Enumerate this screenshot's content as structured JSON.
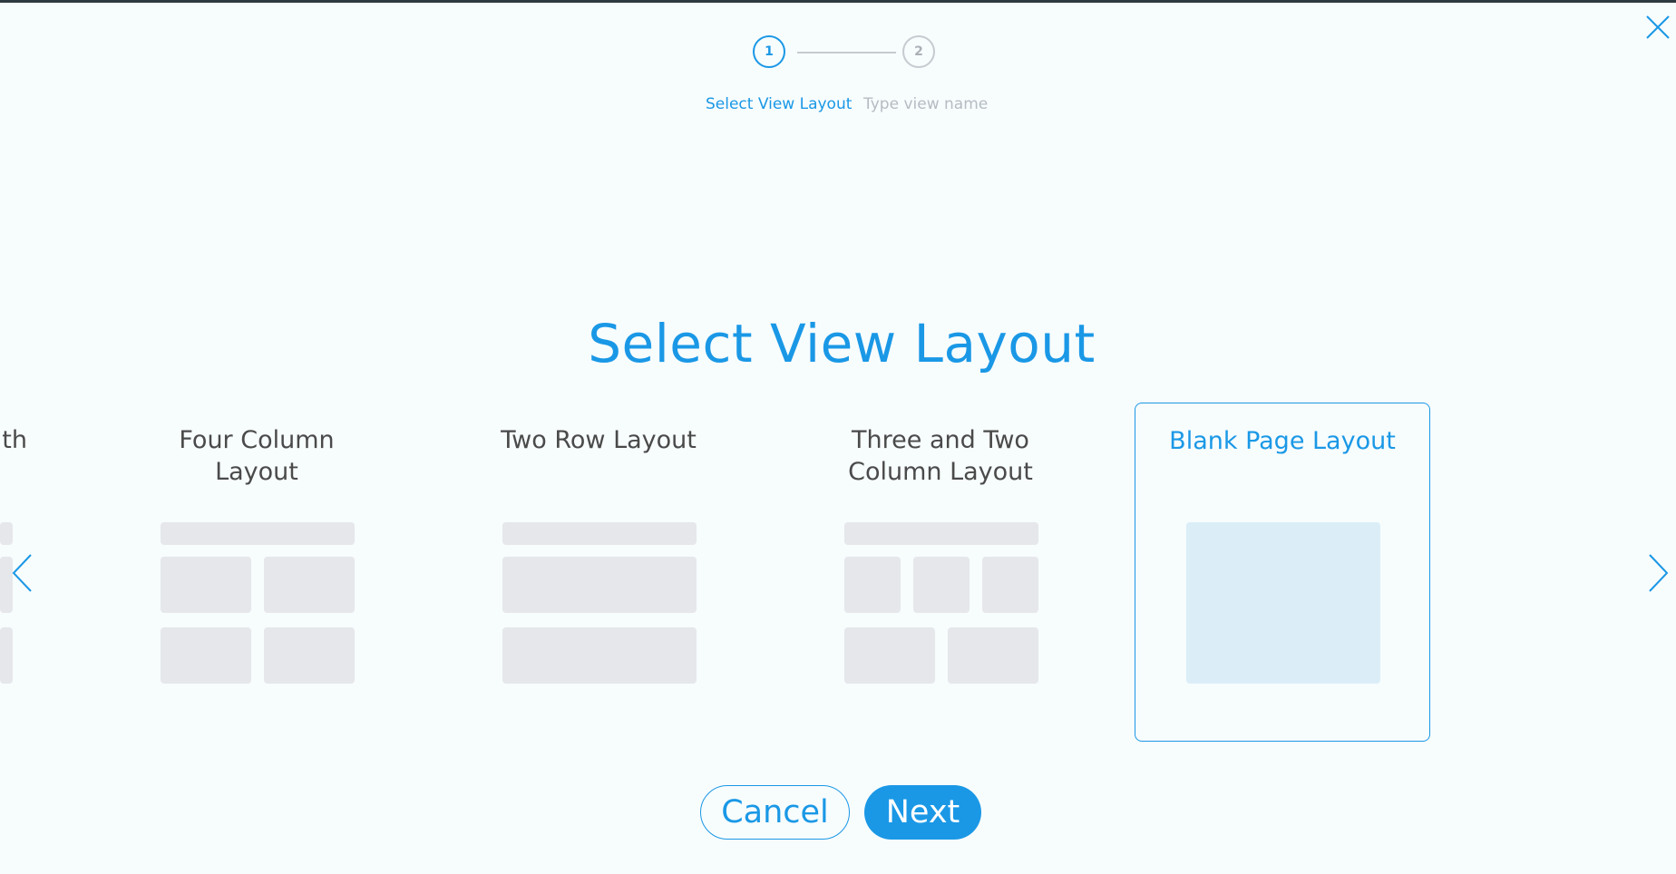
{
  "stepper": {
    "steps": [
      {
        "number": "1",
        "label": "Select View Layout",
        "state": "active"
      },
      {
        "number": "2",
        "label": "Type view name",
        "state": "inactive"
      }
    ]
  },
  "title": "Select View Layout",
  "layouts": [
    {
      "label": "ith",
      "state": "partially-visible"
    },
    {
      "label": "Four Column Layout",
      "state": "normal"
    },
    {
      "label": "Two Row Layout",
      "state": "normal"
    },
    {
      "label": "Three and Two Column Layout",
      "state": "normal"
    },
    {
      "label": "Blank Page Layout",
      "state": "selected"
    }
  ],
  "buttons": {
    "cancel": "Cancel",
    "next": "Next"
  },
  "icons": {
    "close": "close-icon",
    "prev": "chevron-left-icon",
    "next": "chevron-right-icon"
  },
  "colors": {
    "accent": "#1a98e6",
    "placeholder": "#e6e7eb",
    "selected_fill": "#dbeef8",
    "background": "#f7fcfd"
  }
}
